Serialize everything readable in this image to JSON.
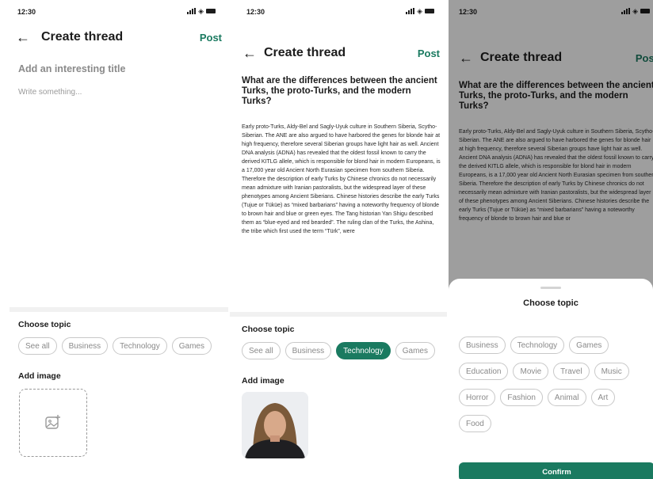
{
  "screen1": {
    "time": "12:30",
    "back_icon": "arrow-left-icon",
    "title": "Create thread",
    "post_label": "Post",
    "title_placeholder": "Add an interesting title",
    "body_placeholder": "Write something...",
    "choose_topic_label": "Choose topic",
    "topics": [
      "See all",
      "Business",
      "Technology",
      "Games"
    ],
    "add_image_label": "Add image",
    "upload_icon": "add-image-icon"
  },
  "screen2": {
    "time": "12:30",
    "title": "Create thread",
    "post_label": "Post",
    "post_title": "What are the differences between the ancient Turks, the proto-Turks, and the modern Turks?",
    "post_body": "Early proto-Turks, Aldy-Bel and Sagly-Uyuk culture in Southern Siberia, Scytho-Siberian. The ANE are also argued to have harbored the genes for blonde hair at high frequency, therefore several Siberian groups have light hair as well. Ancient DNA analysis (ADNA) has revealed that the oldest fossil known to carry the derived KITLG allele, which is responsible for blond hair in modern Europeans, is a 17,000 year old Ancient North Eurasian specimen from southern Siberia. Therefore the description of early Turks by Chinese chronics do not necessarily mean admixture with Iranian pastoralists, but the widespread layer of these phenotypes among Ancient Siberians. Chinese histories describe the early Turks (Tujue or Tüküe) as “mixed barbarians” having a noteworthy frequency of blonde to brown hair and blue or green eyes. The Tang historian Yan Shigu described them as “blue-eyed and red bearded”. The ruling clan of the Turks, the Ashina, the tribe which first used the term “Türk”, were",
    "choose_topic_label": "Choose topic",
    "topics": [
      "See all",
      "Business",
      "Technology",
      "Games"
    ],
    "selected_topic": "Technology",
    "add_image_label": "Add image"
  },
  "screen3": {
    "time": "12:30",
    "title": "Create thread",
    "post_label": "Post",
    "post_title": "What are the differences between the ancient Turks, the proto-Turks, and the modern Turks?",
    "post_body": "Early proto-Turks, Aldy-Bel and Sagly-Uyuk culture in Southern Siberia, Scytho-Siberian. The ANE are also argued to have harbored the genes for blonde hair at high frequency, therefore several Siberian groups have light hair as well. Ancient DNA analysis (ADNA) has revealed that the oldest fossil known to carry the derived KITLG allele, which is responsible for blond hair in modern Europeans, is a 17,000 year old Ancient North Eurasian specimen from southern Siberia. Therefore the description of early Turks by Chinese chronics do not necessarily mean admixture with Iranian pastoralists, but the widespread layer of these phenotypes among Ancient Siberians. Chinese histories describe the early Turks (Tujue or Tüküe) as “mixed barbarians” having a noteworthy frequency of blonde to brown hair and blue or",
    "sheet": {
      "title": "Choose topic",
      "topics_row1": [
        "Business",
        "Technology",
        "Games"
      ],
      "topics_row2": [
        "Education",
        "Movie",
        "Travel",
        "Music"
      ],
      "topics_row3": [
        "Horror",
        "Fashion",
        "Animal",
        "Art"
      ],
      "topics_row4": [
        "Food"
      ],
      "confirm_label": "Confirm"
    }
  },
  "colors": {
    "accent": "#1a7a60",
    "chip_border": "#c8c8c8",
    "placeholder": "#8a8a8a"
  }
}
